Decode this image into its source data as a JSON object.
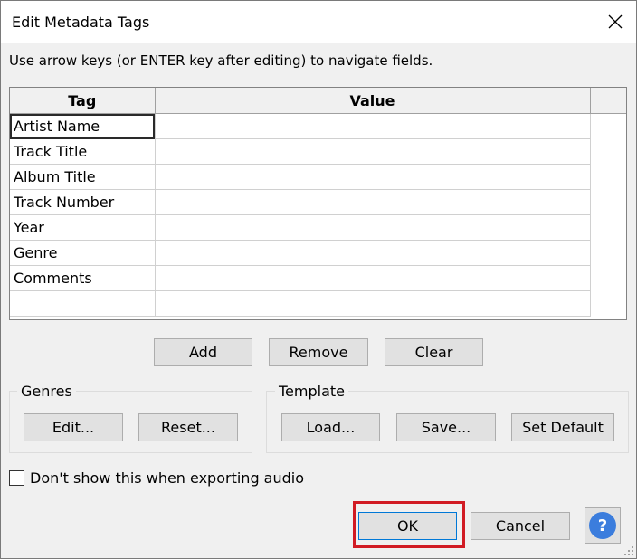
{
  "window": {
    "title": "Edit Metadata Tags"
  },
  "instructions": "Use arrow keys (or ENTER key after editing) to navigate fields.",
  "grid": {
    "headers": {
      "tag": "Tag",
      "value": "Value"
    },
    "rows": [
      {
        "tag": "Artist Name",
        "value": ""
      },
      {
        "tag": "Track Title",
        "value": ""
      },
      {
        "tag": "Album Title",
        "value": ""
      },
      {
        "tag": "Track Number",
        "value": ""
      },
      {
        "tag": "Year",
        "value": ""
      },
      {
        "tag": "Genre",
        "value": ""
      },
      {
        "tag": "Comments",
        "value": ""
      },
      {
        "tag": "",
        "value": ""
      }
    ]
  },
  "row_buttons": {
    "add": "Add",
    "remove": "Remove",
    "clear": "Clear"
  },
  "genres": {
    "label": "Genres",
    "edit": "Edit...",
    "reset": "Reset..."
  },
  "template": {
    "label": "Template",
    "load": "Load...",
    "save": "Save...",
    "set_default": "Set Default"
  },
  "checkbox": {
    "label": "Don't show this when exporting audio",
    "checked": false
  },
  "footer": {
    "ok": "OK",
    "cancel": "Cancel",
    "help_glyph": "?"
  },
  "colors": {
    "highlight": "#d11b24",
    "help_icon": "#3b7ddd"
  }
}
